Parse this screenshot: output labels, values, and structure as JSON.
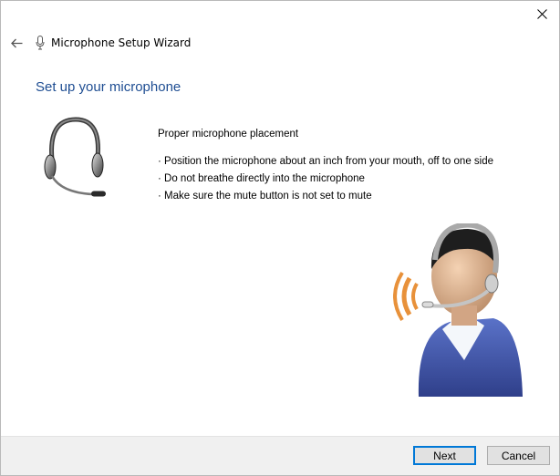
{
  "window": {
    "title": "Microphone Setup Wizard"
  },
  "page": {
    "heading": "Set up your microphone",
    "subheading": "Proper microphone placement",
    "instructions": [
      "· Position the microphone about an inch from your mouth, off to one side",
      "· Do not breathe directly into the microphone",
      "· Make sure the mute button is not set to mute"
    ]
  },
  "buttons": {
    "next": "Next",
    "cancel": "Cancel"
  },
  "icons": {
    "back": "back-arrow-icon",
    "close": "close-icon",
    "title": "microphone-icon",
    "headset": "headset-icon",
    "user": "user-speaking-icon"
  },
  "colors": {
    "heading": "#1e4d92",
    "accent": "#0078d7",
    "footer": "#f0f0f0"
  }
}
